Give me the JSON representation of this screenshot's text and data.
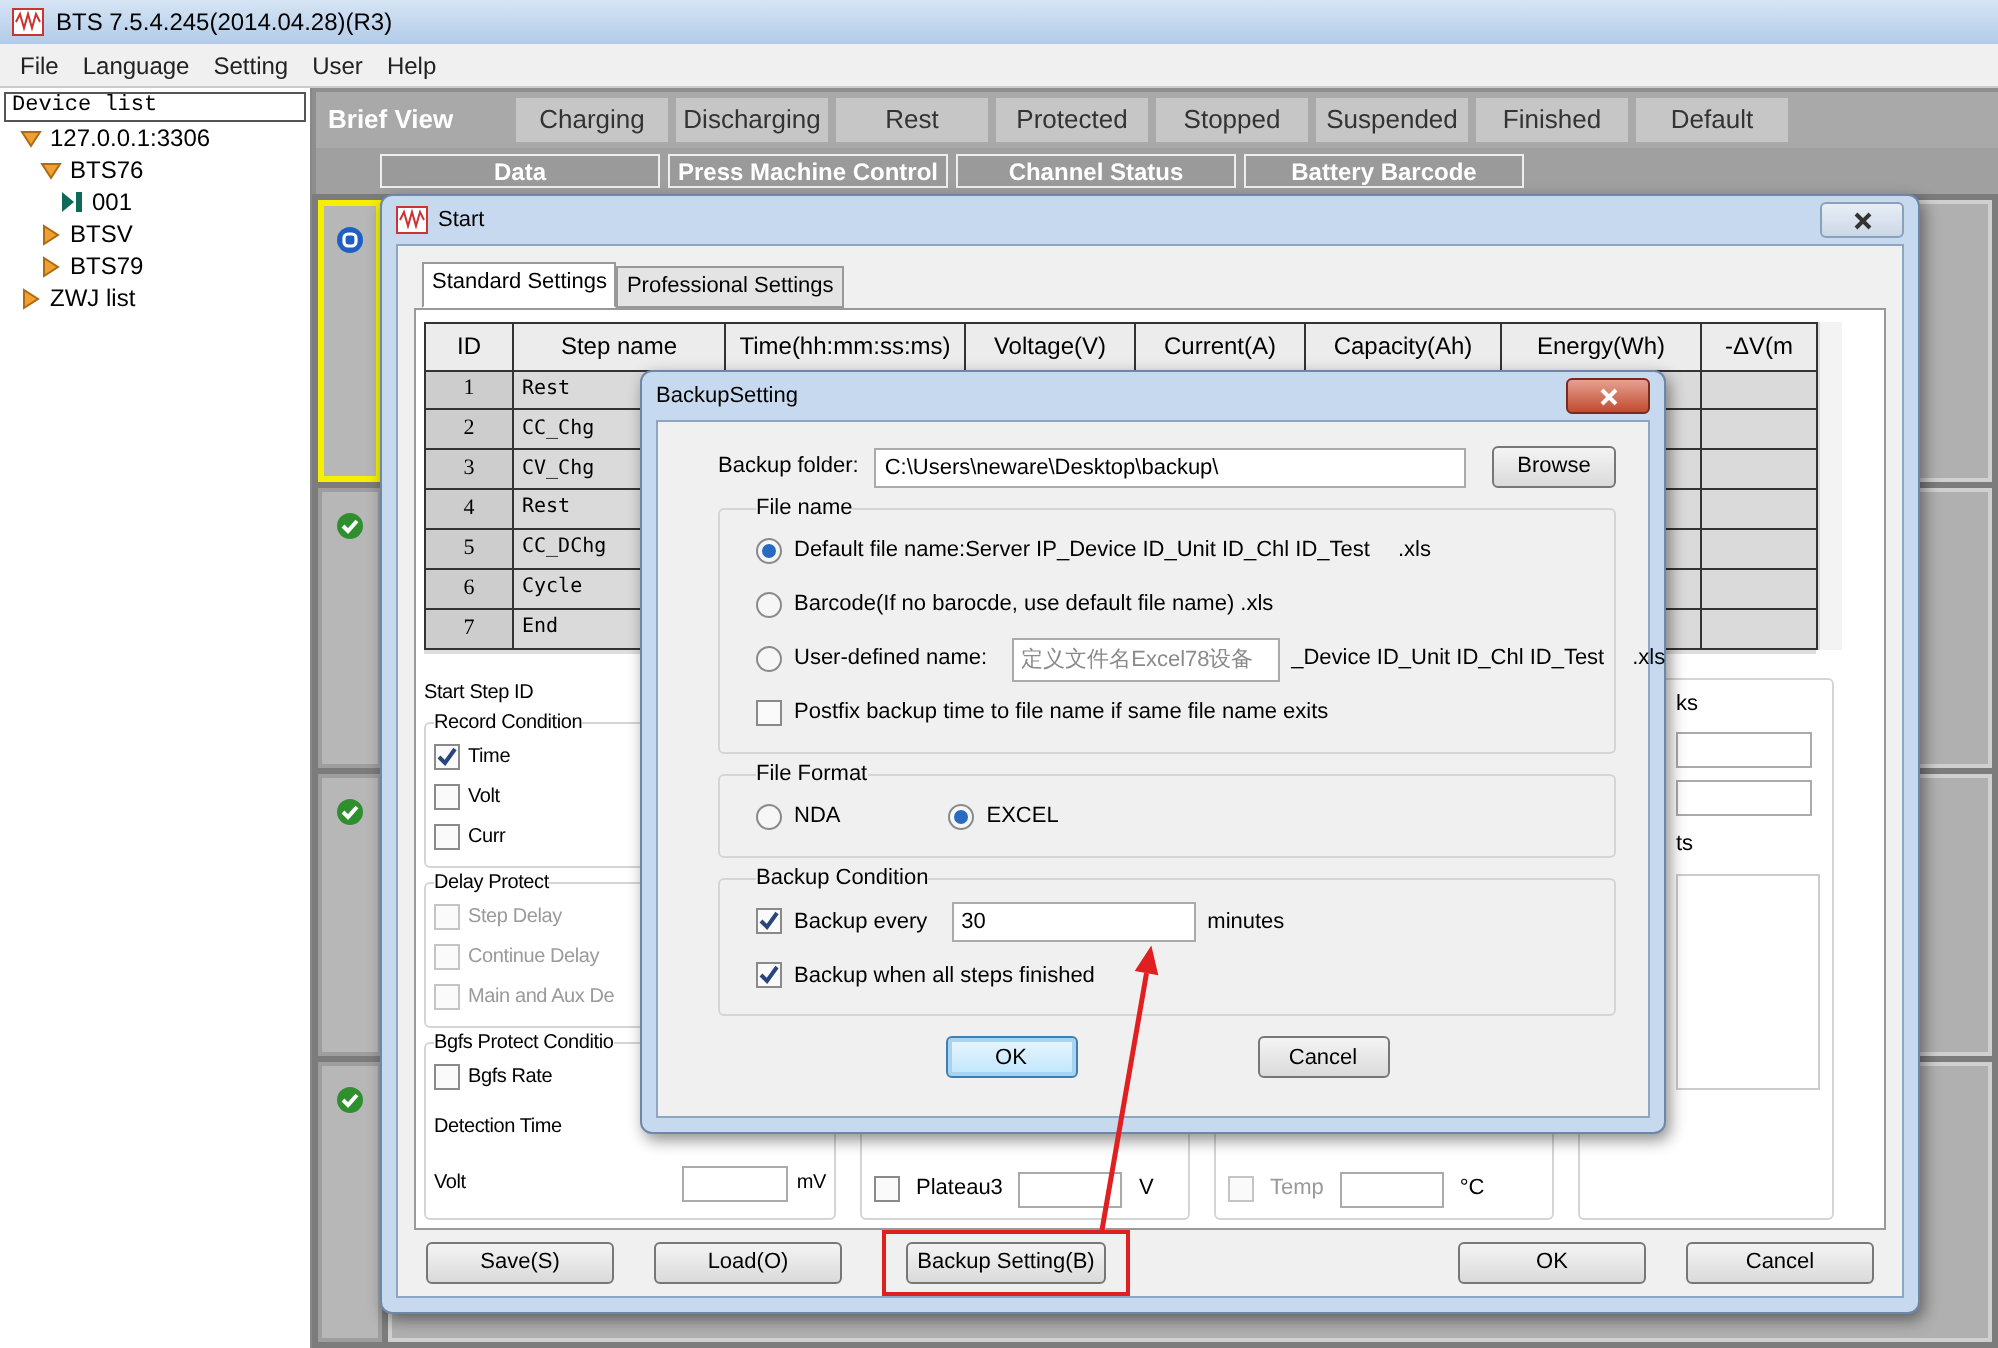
{
  "window": {
    "title": "BTS 7.5.4.245(2014.04.28)(R3)"
  },
  "menu": [
    "File",
    "Language",
    "Setting",
    "User",
    "Help"
  ],
  "device_list": {
    "title": "Device list",
    "tree": [
      {
        "label": "127.0.0.1:3306",
        "expanded": true,
        "children": [
          {
            "label": "BTS76",
            "expanded": true,
            "children": [
              {
                "label": "001"
              }
            ]
          },
          {
            "label": "BTSV",
            "expanded": false
          },
          {
            "label": "BTS79",
            "expanded": false
          }
        ]
      },
      {
        "label": "ZWJ list",
        "expanded": false
      }
    ]
  },
  "status_filter": {
    "label": "Brief View",
    "items": [
      "Charging",
      "Discharging",
      "Rest",
      "Protected",
      "Stopped",
      "Suspended",
      "Finished",
      "Default"
    ]
  },
  "view_tabs": [
    "Data",
    "Press Machine Control",
    "Channel Status",
    "Battery Barcode"
  ],
  "channels": [
    {
      "kind": "running",
      "selected": true
    },
    {
      "kind": "done",
      "selected": false
    },
    {
      "kind": "done",
      "selected": false
    },
    {
      "kind": "done",
      "selected": false
    }
  ],
  "start_dialog": {
    "title": "Start",
    "tabs": [
      {
        "label": "Standard Settings",
        "selected": true
      },
      {
        "label": "Professional Settings",
        "selected": false
      }
    ],
    "table": {
      "columns": [
        "ID",
        "Step name",
        "Time(hh:mm:ss:ms)",
        "Voltage(V)",
        "Current(A)",
        "Capacity(Ah)",
        "Energy(Wh)",
        "-ΔV(m"
      ],
      "rows": [
        {
          "id": "1",
          "step_name": "Rest"
        },
        {
          "id": "2",
          "step_name": "CC_Chg"
        },
        {
          "id": "3",
          "step_name": "CV_Chg"
        },
        {
          "id": "4",
          "step_name": "Rest"
        },
        {
          "id": "5",
          "step_name": "CC_DChg"
        },
        {
          "id": "6",
          "step_name": "Cycle"
        },
        {
          "id": "7",
          "step_name": "End"
        }
      ]
    },
    "start_step_label": "Start Step ID",
    "record_condition": {
      "title": "Record Condition",
      "options": [
        {
          "label": "Time",
          "checked": true,
          "disabled": false
        },
        {
          "label": "Volt",
          "checked": false,
          "disabled": false
        },
        {
          "label": "Curr",
          "checked": false,
          "disabled": false
        }
      ]
    },
    "delay_protect": {
      "title": "Delay Protect",
      "options": [
        {
          "label": "Step Delay",
          "checked": false,
          "disabled": true
        },
        {
          "label": "Continue Delay",
          "checked": false,
          "disabled": true
        },
        {
          "label": "Main and Aux De",
          "checked": false,
          "disabled": true
        }
      ]
    },
    "bgfs_protect": {
      "title": "Bgfs Protect Conditio",
      "rate": {
        "label": "Bgfs Rate",
        "checked": false,
        "disabled": false
      },
      "detection_time_label": "Detection Time",
      "volt_label": "Volt",
      "volt_unit": "mV"
    },
    "plateau": {
      "label": "Plateau3",
      "checked": false,
      "disabled": false,
      "unit": "V"
    },
    "temp": {
      "label": "Temp",
      "checked": false,
      "disabled": true,
      "unit": "°C"
    },
    "right_group": {
      "label_1": "ks",
      "label_2": "ts"
    },
    "buttons": [
      {
        "label": "Save(S)",
        "highlighted": false
      },
      {
        "label": "Load(O)",
        "highlighted": false
      },
      {
        "label": "Backup Setting(B)",
        "highlighted": true
      },
      {
        "label": "OK",
        "highlighted": false
      },
      {
        "label": "Cancel",
        "highlighted": false
      }
    ]
  },
  "backup_dialog": {
    "title": "BackupSetting",
    "folder_label": "Backup folder:",
    "folder_value": "C:\\Users\\neware\\Desktop\\backup\\",
    "browse": "Browse",
    "file_name": {
      "title": "File name",
      "options": [
        {
          "kind": "pattern",
          "label": "Default file name:Server IP_Device ID_Unit ID_Chl ID_Test",
          "suffix": ".xls",
          "selected": true
        },
        {
          "kind": "plain",
          "label": "Barcode(If no barocde, use default file name) .xls",
          "selected": false
        },
        {
          "kind": "custom",
          "label": "User-defined name:",
          "value": "定义文件名Excel78设备",
          "pattern": "_Device ID_Unit ID_Chl ID_Test",
          "suffix": ".xls",
          "selected": false
        }
      ],
      "postfix": {
        "label": "Postfix backup time to file name if same file name exits",
        "checked": false
      }
    },
    "file_format": {
      "title": "File Format",
      "options": [
        {
          "label": "NDA",
          "selected": false
        },
        {
          "label": "EXCEL",
          "selected": true
        }
      ]
    },
    "backup_condition": {
      "title": "Backup Condition",
      "every": {
        "label": "Backup every",
        "checked": true,
        "value": "30",
        "unit": "minutes"
      },
      "when_finished": {
        "label": "Backup when all steps finished",
        "checked": true
      }
    },
    "buttons": [
      {
        "label": "OK",
        "focused": true
      },
      {
        "label": "Cancel",
        "focused": false
      }
    ]
  }
}
